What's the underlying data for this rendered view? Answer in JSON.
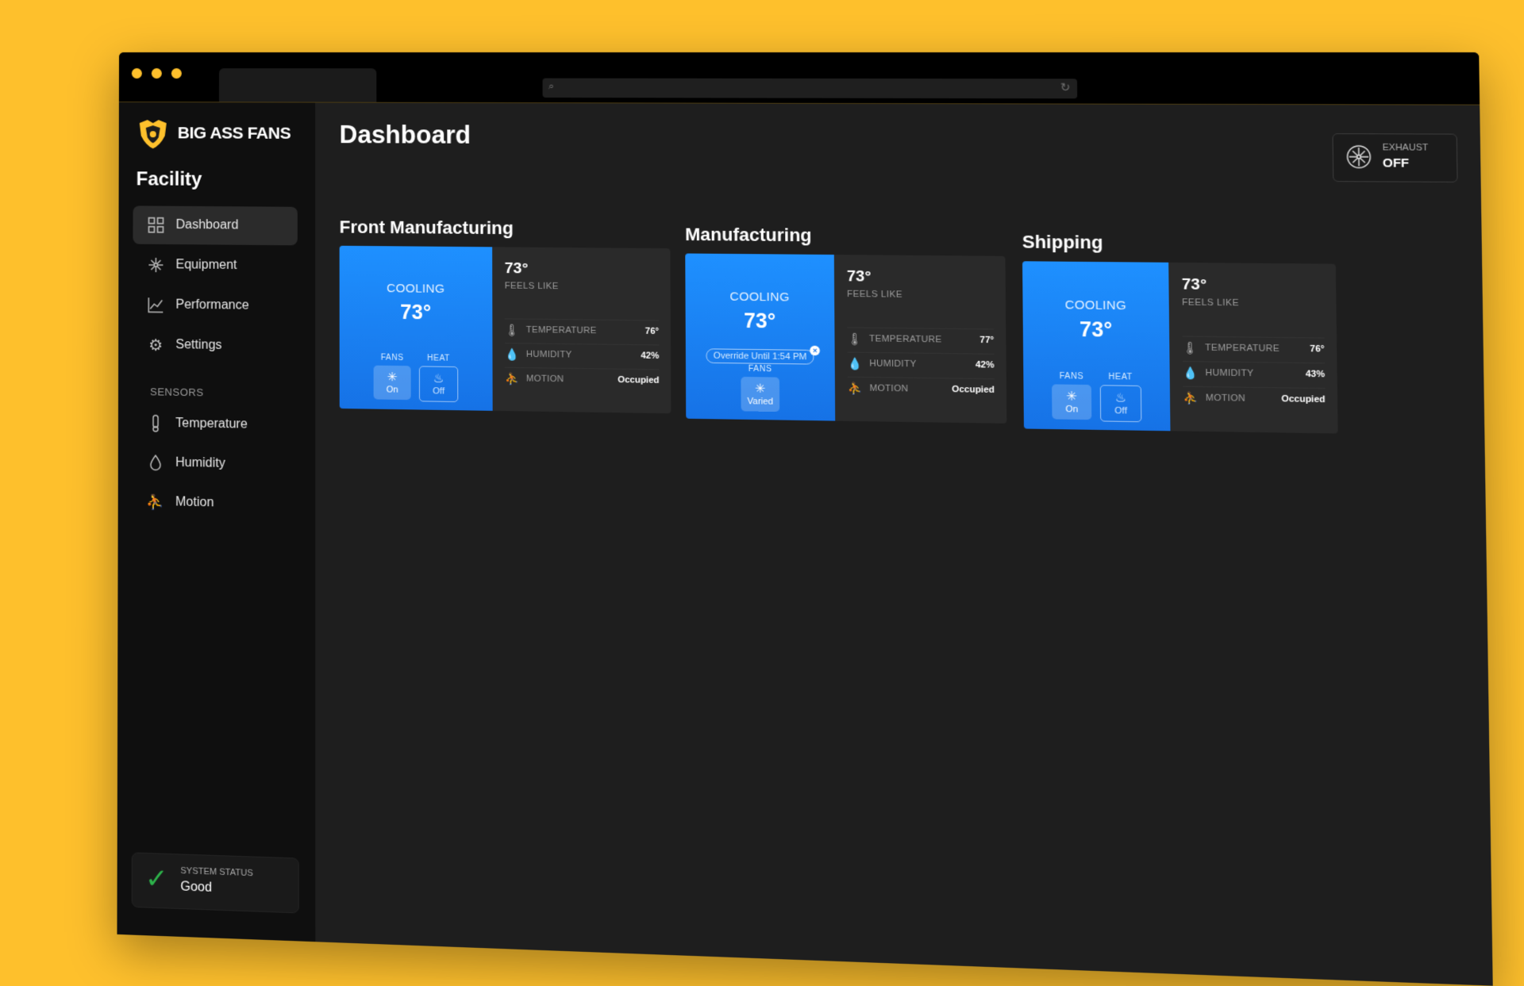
{
  "brand": {
    "name": "BIG ASS FANS",
    "accent": "#FEC02C",
    "blue": "#1E90FF",
    "good": "#2DB24A"
  },
  "sidebar": {
    "section_title": "Facility",
    "nav": [
      {
        "label": "Dashboard",
        "icon": "grid-icon",
        "active": true
      },
      {
        "label": "Equipment",
        "icon": "fan-icon",
        "active": false
      },
      {
        "label": "Performance",
        "icon": "chart-icon",
        "active": false
      },
      {
        "label": "Settings",
        "icon": "gear-icon",
        "active": false
      }
    ],
    "sensors_heading": "SENSORS",
    "sensors": [
      {
        "label": "Temperature",
        "icon": "thermometer-icon"
      },
      {
        "label": "Humidity",
        "icon": "droplet-icon"
      },
      {
        "label": "Motion",
        "icon": "motion-icon"
      }
    ],
    "system_status": {
      "label": "SYSTEM STATUS",
      "value": "Good"
    }
  },
  "main": {
    "title": "Dashboard",
    "exhaust": {
      "label": "EXHAUST",
      "value": "OFF"
    },
    "zones": [
      {
        "name": "Front Manufacturing",
        "mode": "COOLING",
        "setpoint": "73°",
        "feels_like": "73°",
        "feels_like_label": "FEELS LIKE",
        "fans_label": "FANS",
        "fans_value": "On",
        "heat_label": "HEAT",
        "heat_value": "Off",
        "metrics": [
          {
            "label": "TEMPERATURE",
            "value": "76°"
          },
          {
            "label": "HUMIDITY",
            "value": "42%"
          },
          {
            "label": "MOTION",
            "value": "Occupied"
          }
        ]
      },
      {
        "name": "Manufacturing",
        "mode": "COOLING",
        "setpoint": "73°",
        "override": "Override Until 1:54 PM",
        "feels_like": "73°",
        "feels_like_label": "FEELS LIKE",
        "fans_label": "FANS",
        "fans_value": "Varied",
        "metrics": [
          {
            "label": "TEMPERATURE",
            "value": "77°"
          },
          {
            "label": "HUMIDITY",
            "value": "42%"
          },
          {
            "label": "MOTION",
            "value": "Occupied"
          }
        ]
      },
      {
        "name": "Shipping",
        "mode": "COOLING",
        "setpoint": "73°",
        "feels_like": "73°",
        "feels_like_label": "FEELS LIKE",
        "fans_label": "FANS",
        "fans_value": "On",
        "heat_label": "HEAT",
        "heat_value": "Off",
        "metrics": [
          {
            "label": "TEMPERATURE",
            "value": "76°"
          },
          {
            "label": "HUMIDITY",
            "value": "43%"
          },
          {
            "label": "MOTION",
            "value": "Occupied"
          }
        ]
      }
    ]
  }
}
